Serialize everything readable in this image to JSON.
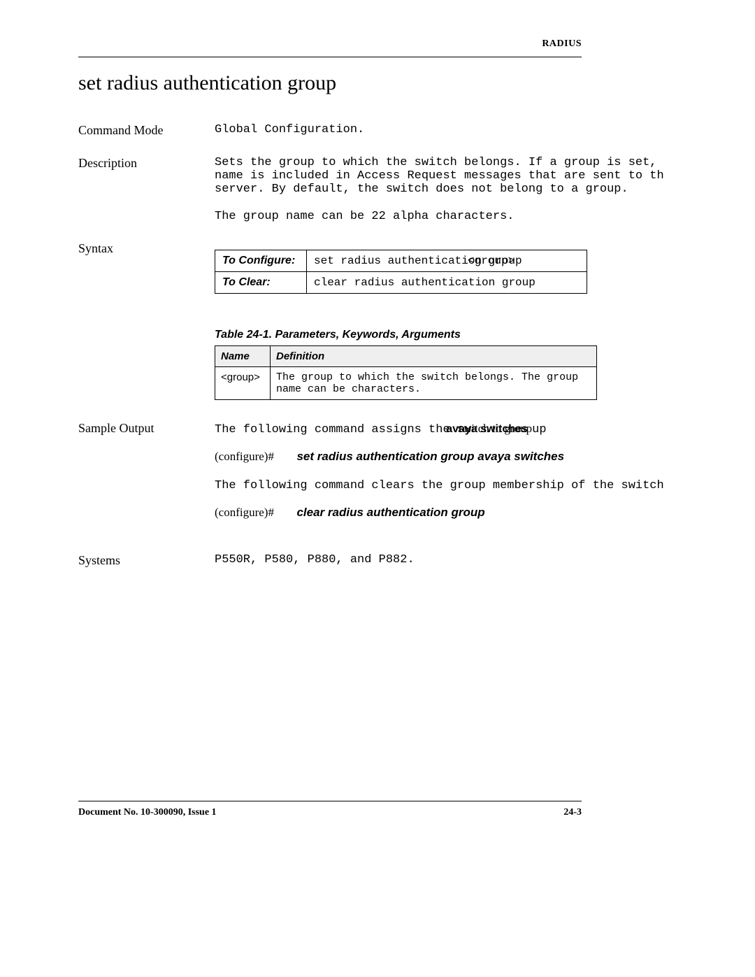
{
  "header": {
    "section": "RADIUS"
  },
  "title": "set radius authentication group",
  "fields": {
    "commandMode": {
      "label": "Command Mode",
      "value": "Global Configuration."
    },
    "description": {
      "label": "Description",
      "p1": "Sets the group to which the switch belongs. If a group is set, name is included in Access Request messages that are sent to th server. By default, the switch does not belong to a group.",
      "p2": "The group name can be 22 alpha characters."
    },
    "syntax": {
      "label": "Syntax",
      "rows": [
        {
          "label": "To Configure:",
          "value_base": "set radius authenticat",
          "value_overlap": "<group>",
          "value_trail": "group",
          "value_overlap2": "ion "
        },
        {
          "label": "To Clear:",
          "value": "clear radius authentication group"
        }
      ]
    },
    "paramTable": {
      "caption": "Table 24-1.  Parameters, Keywords, Arguments",
      "headers": [
        "Name",
        "Definition"
      ],
      "rows": [
        {
          "name": "<group>",
          "def": "The group to which the switch belongs. The group name can be characters."
        }
      ]
    },
    "sampleOutput": {
      "label": "Sample Output",
      "line1_pre": "The following command assigns the sw",
      "line1_mid_mono": "avaya switches",
      "line1_mid_serif": "itch to group",
      "line1_mid_bold": "avaya switches",
      "line1_suf_mono": "up",
      "prompt": "(configure)#",
      "cmd1": "set radius authentication group avaya switches",
      "line2": "The following command clears the group membership of the switch",
      "cmd2": "clear radius authentication group"
    },
    "systems": {
      "label": "Systems",
      "value": "P550R, P580, P880, and P882."
    }
  },
  "footer": {
    "left": "Document No. 10-300090, Issue 1",
    "right": "24-3"
  }
}
